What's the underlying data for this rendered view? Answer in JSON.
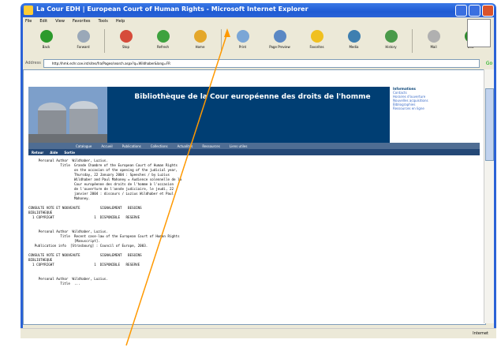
{
  "window": {
    "title": "La Cour EDH | European Court of Human Rights - Microsoft Internet Explorer"
  },
  "menubar": [
    "File",
    "Edit",
    "View",
    "Favorites",
    "Tools",
    "Help"
  ],
  "toolbar": {
    "buttons": [
      {
        "label": "Back",
        "icon": "back-icon",
        "color": "#2c9a2c"
      },
      {
        "label": "Forward",
        "icon": "forward-icon",
        "color": "#9aa8b8"
      },
      {
        "label": "Stop",
        "icon": "stop-icon",
        "color": "#d64b3a"
      },
      {
        "label": "Refresh",
        "icon": "refresh-icon",
        "color": "#3ea23e"
      },
      {
        "label": "Home",
        "icon": "home-icon",
        "color": "#e4a72a"
      },
      {
        "label": "Print",
        "icon": "print-icon",
        "color": "#7aa6d6"
      },
      {
        "label": "Page Preview",
        "icon": "page-icon",
        "color": "#5b88c4"
      },
      {
        "label": "Favorites",
        "icon": "star-icon",
        "color": "#f0c020"
      },
      {
        "label": "Media",
        "icon": "media-icon",
        "color": "#3e7fb0"
      },
      {
        "label": "History",
        "icon": "history-icon",
        "color": "#4a9a4a"
      },
      {
        "label": "Mail",
        "icon": "mail-icon",
        "color": "#b0b0b0"
      },
      {
        "label": "Edit",
        "icon": "edit-icon",
        "color": "#2e8a2e"
      }
    ]
  },
  "addressbar": {
    "label": "Address",
    "value": "http://hmk.echr.coe.int/sites/fra/Pages/search.aspx?q=Wildhaber&lang=FR",
    "go_label": "Go"
  },
  "page": {
    "banner_title": "Bibliothèque de la Cour européenne des droits de l'homme",
    "side_heading": "Informations",
    "side_links": [
      "Contacts",
      "Horaires d'ouverture",
      "Nouvelles acquisitions",
      "Bibliographies",
      "Ressources en ligne"
    ],
    "nav_items": [
      "Catalogue",
      "Accueil",
      "Publications",
      "Collections",
      "Actualités",
      "Ressources",
      "Liens utiles"
    ],
    "subnav_items": [
      "Retour",
      "Aide",
      "Sortie"
    ],
    "records": "     Personal Author  Wildhaber, Luzius.\n                Title  Grande Chambre of the European Court of Human Rights\n                       on the occasion of the opening of the judicial year,\n                       Thursday, 22 January 2004 : Speeches / by Luzius\n                       Wildhaber and Paul Mahoney = Audience solennelle de la\n                       Cour européenne des droits de l'homme à l'occasion\n                       de l'ouverture de l'année judiciaire, le jeudi, 22\n                       janvier 2004 : discours / Luzius Wildhaber et Paul\n                       Mahoney.\n\nCONSULTE VOTE ET NOUVEAUTE          SIGNALEMENT   BESOINS\nBIBLIOTHEQUE\n  1 COPYRIGHT                    1  DISPONIBLE   RESERVE\n\n\n     Personal Author  Wildhaber, Luzius.\n                Title  Recent case-law of the European Court of Human Rights\n                       [Manuscript].\n   Publication info  [Strasbourg] : Council of Europe, 2003.\n\nCONSULTE VOTE ET NOUVEAUTE          SIGNALEMENT   BESOINS\nBIBLIOTHEQUE\n  1 COPYRIGHT                    1  DISPONIBLE   RESERVE\n\n\n     Personal Author  Wildhaber, Luzius.\n                Title  ..."
  },
  "status": {
    "text": "",
    "zone": "Internet"
  },
  "colors": {
    "annotation_arrow": "#ff9900",
    "banner": "#003e73",
    "nav": "#4f6d93"
  }
}
